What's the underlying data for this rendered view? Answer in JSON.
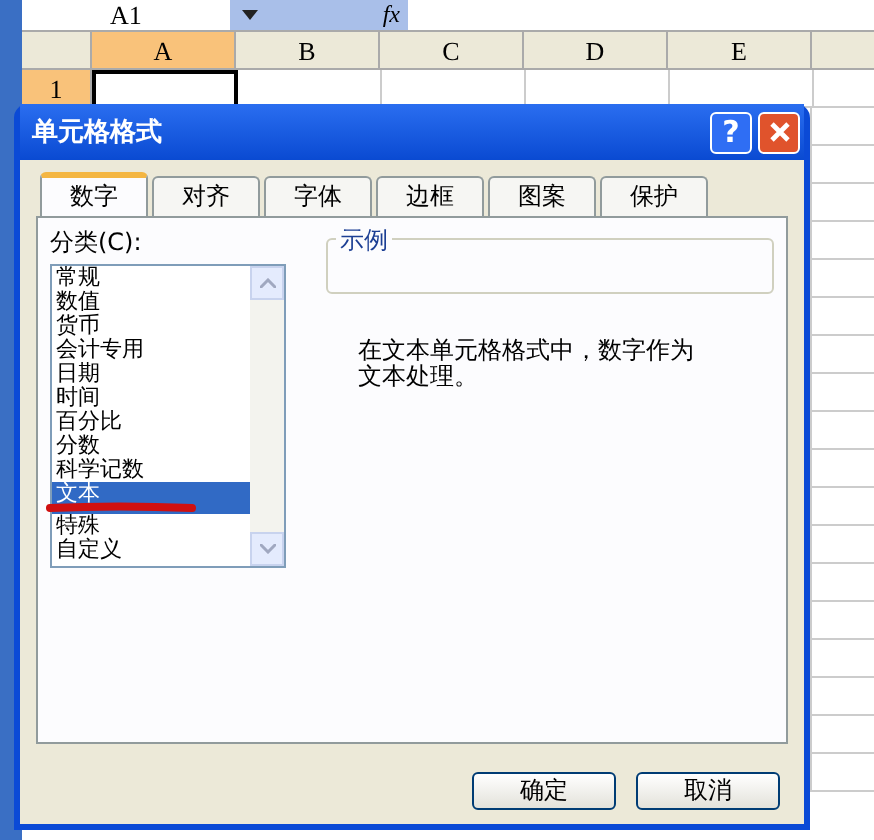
{
  "name_box": "A1",
  "formula_label": "fx",
  "columns": [
    {
      "label": "A",
      "selected": true
    },
    {
      "label": "B",
      "selected": false
    },
    {
      "label": "C",
      "selected": false
    },
    {
      "label": "D",
      "selected": false
    },
    {
      "label": "E",
      "selected": false
    }
  ],
  "rows": [
    {
      "label": "1",
      "selected": true
    }
  ],
  "dialog": {
    "title": "单元格格式",
    "help": "?",
    "tabs": [
      {
        "label": "数字",
        "selected": true
      },
      {
        "label": "对齐",
        "selected": false
      },
      {
        "label": "字体",
        "selected": false
      },
      {
        "label": "边框",
        "selected": false
      },
      {
        "label": "图案",
        "selected": false
      },
      {
        "label": "保护",
        "selected": false
      }
    ],
    "category_label": "分类(C):",
    "categories": [
      {
        "label": "常规",
        "selected": false
      },
      {
        "label": "数值",
        "selected": false
      },
      {
        "label": "货币",
        "selected": false
      },
      {
        "label": "会计专用",
        "selected": false
      },
      {
        "label": "日期",
        "selected": false
      },
      {
        "label": "时间",
        "selected": false
      },
      {
        "label": "百分比",
        "selected": false
      },
      {
        "label": "分数",
        "selected": false
      },
      {
        "label": "科学记数",
        "selected": false
      },
      {
        "label": "文本",
        "selected": true
      },
      {
        "label": "特殊",
        "selected": false
      },
      {
        "label": "自定义",
        "selected": false
      }
    ],
    "sample_label": "示例",
    "description": "在文本单元格格式中，数字作为文本处理。",
    "buttons": [
      "确定",
      "取消"
    ]
  }
}
